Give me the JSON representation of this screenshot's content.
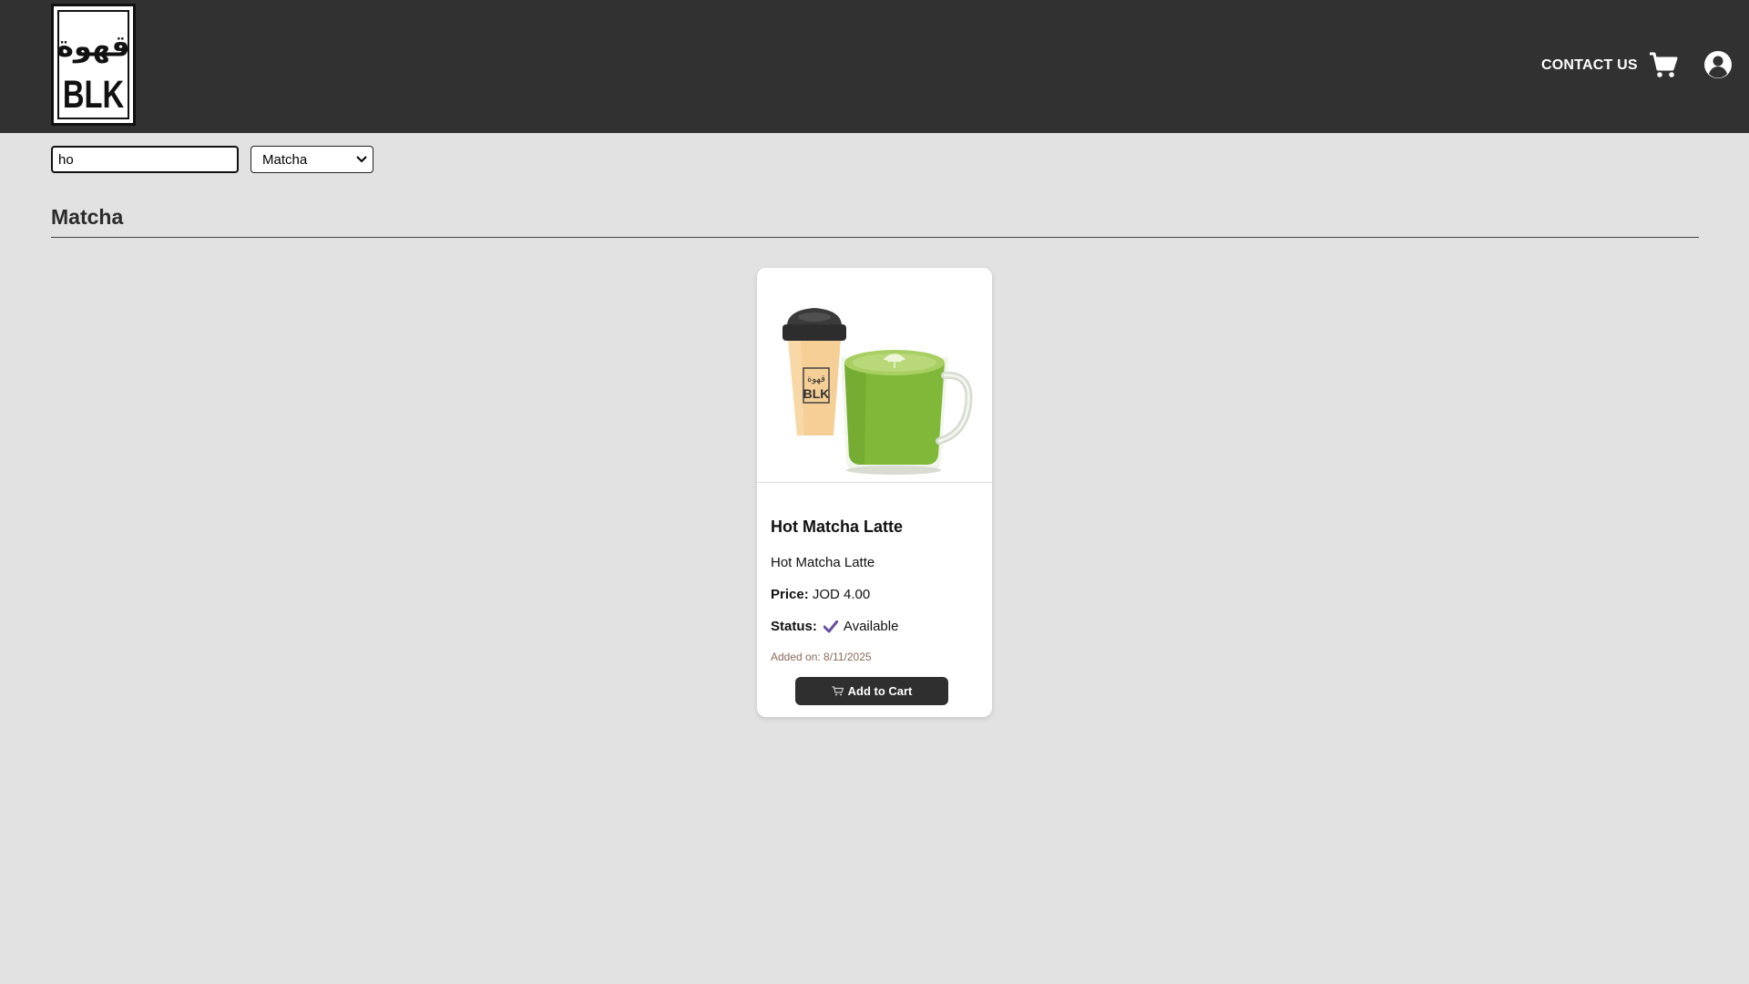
{
  "header": {
    "logo_text": "BLK",
    "logo_arabic": "قهوة",
    "contact_label": "CONTACT US",
    "cart_icon": "shopping-cart-icon",
    "account_icon": "user-circle-icon"
  },
  "filters": {
    "search_value": "ho",
    "category_selected": "Matcha"
  },
  "section": {
    "title": "Matcha"
  },
  "products": [
    {
      "name": "Hot Matcha Latte",
      "description": "Hot Matcha Latte",
      "price_label": "Price:",
      "price": "JOD 4.00",
      "status_label": "Status:",
      "status": "Available",
      "added_on": "Added on: 8/11/2025",
      "button_label": "Add to Cart",
      "cup_logo_arabic": "قهوة",
      "cup_logo_text": "BLK"
    }
  ],
  "colors": {
    "header_bg": "#313131",
    "page_bg": "#e2e2e2",
    "matcha_green": "#7cb342",
    "check_purple": "#6a4fa0",
    "button_bg": "#2f2f2f"
  }
}
